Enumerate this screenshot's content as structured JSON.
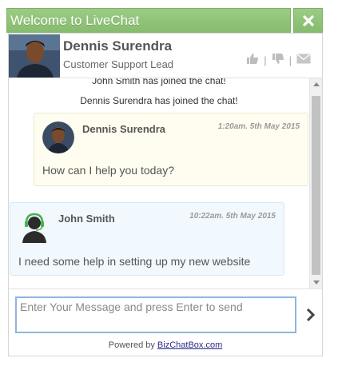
{
  "window": {
    "title": "Welcome to LiveChat",
    "close_icon": "close-icon"
  },
  "agent": {
    "name": "Dennis Surendra",
    "role": "Customer Support Lead",
    "actions": {
      "like_icon": "thumbs-up-icon",
      "dislike_icon": "thumbs-down-icon",
      "email_icon": "envelope-icon",
      "separator": "|"
    }
  },
  "messages": {
    "system": [
      "John Smith has joined the chat!",
      "Dennis Surendra has joined the chat!"
    ],
    "chat": [
      {
        "sender": "Dennis Surendra",
        "time": "1:20am. 5th May 2015",
        "text": "How can I help you today?"
      },
      {
        "sender": "John Smith",
        "time": "10:22am. 5th May 2015",
        "text": "I need some help in setting up my new website"
      }
    ]
  },
  "input": {
    "placeholder": "Enter Your Message and press Enter to send",
    "value": "",
    "send_icon": "chevron-right-icon"
  },
  "footer": {
    "powered_prefix": "Powered by ",
    "powered_link": "BizChatBox.com"
  },
  "colors": {
    "header_green": "#8fc378",
    "agent_bubble": "#fffdf0",
    "user_bubble": "#f1f8fe",
    "input_border": "#8fb5e2"
  }
}
